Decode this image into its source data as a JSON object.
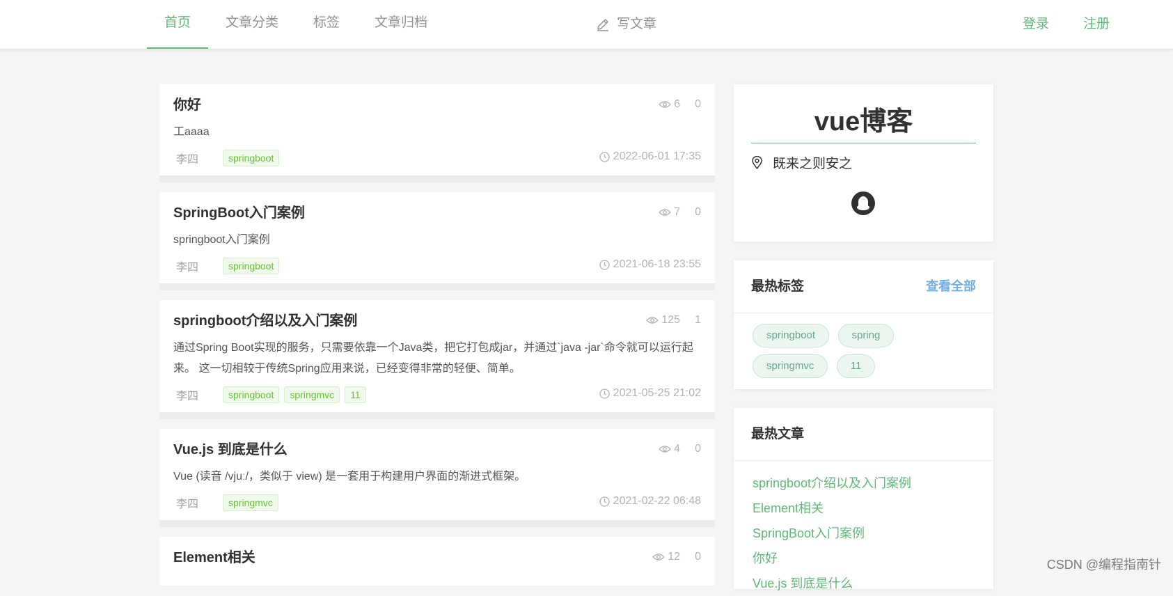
{
  "nav": {
    "items": [
      {
        "label": "首页",
        "active": true
      },
      {
        "label": "文章分类",
        "active": false
      },
      {
        "label": "标签",
        "active": false
      },
      {
        "label": "文章归档",
        "active": false
      }
    ],
    "write_label": "写文章",
    "login_label": "登录",
    "register_label": "注册"
  },
  "articles": [
    {
      "title": "你好",
      "views": "6",
      "comments": "0",
      "summary": "工aaaa",
      "author": "李四",
      "tags": [
        "springboot"
      ],
      "time": "2022-06-01 17:35"
    },
    {
      "title": "SpringBoot入门案例",
      "views": "7",
      "comments": "0",
      "summary": "springboot入门案例",
      "author": "李四",
      "tags": [
        "springboot"
      ],
      "time": "2021-06-18 23:55"
    },
    {
      "title": "springboot介绍以及入门案例",
      "views": "125",
      "comments": "1",
      "summary": "通过Spring Boot实现的服务，只需要依靠一个Java类，把它打包成jar，并通过`java -jar`命令就可以运行起来。 这一切相较于传统Spring应用来说，已经变得非常的轻便、简单。",
      "author": "李四",
      "tags": [
        "springboot",
        "springmvc",
        "11"
      ],
      "time": "2021-05-25 21:02"
    },
    {
      "title": "Vue.js 到底是什么",
      "views": "4",
      "comments": "0",
      "summary": "Vue (读音 /vjuː/，类似于 view) 是一套用于构建用户界面的渐进式框架。",
      "author": "李四",
      "tags": [
        "springmvc"
      ],
      "time": "2021-02-22 06:48"
    },
    {
      "title": "Element相关",
      "views": "12",
      "comments": "0"
    }
  ],
  "sidebar": {
    "blog_name": "vue博客",
    "motto": "既来之则安之",
    "hot_tags": {
      "title": "最热标签",
      "more_label": "查看全部",
      "tags": [
        "springboot",
        "spring",
        "springmvc",
        "11"
      ]
    },
    "hot_articles": {
      "title": "最热文章",
      "items": [
        "springboot介绍以及入门案例",
        "Element相关",
        "SpringBoot入门案例",
        "你好",
        "Vue.js 到底是什么"
      ]
    }
  },
  "watermark": "CSDN @编程指南针",
  "colors": {
    "accent": "#5fb878",
    "link_blue": "#72aee6",
    "tag_green": "#67c23a"
  }
}
